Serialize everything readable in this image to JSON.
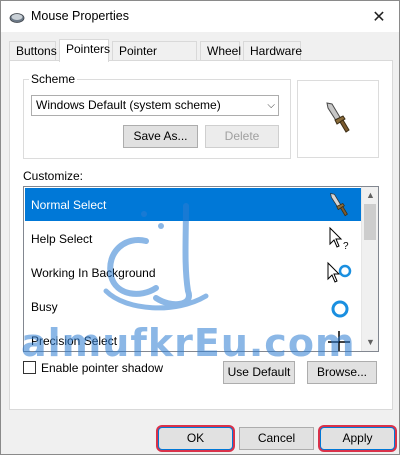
{
  "window": {
    "title": "Mouse Properties",
    "close_glyph": "✕"
  },
  "tabs": [
    {
      "label": "Buttons",
      "active": false
    },
    {
      "label": "Pointers",
      "active": true
    },
    {
      "label": "Pointer Options",
      "active": false
    },
    {
      "label": "Wheel",
      "active": false
    },
    {
      "label": "Hardware",
      "active": false
    }
  ],
  "scheme": {
    "group_label": "Scheme",
    "selected": "Windows Default (system scheme)",
    "save_as_label": "Save As...",
    "delete_label": "Delete"
  },
  "customize": {
    "label": "Customize:",
    "items": [
      {
        "name": "Normal Select",
        "selected": true,
        "icon": "sword-cursor-icon"
      },
      {
        "name": "Help Select",
        "selected": false,
        "icon": "help-select-cursor-icon"
      },
      {
        "name": "Working In Background",
        "selected": false,
        "icon": "working-background-cursor-icon"
      },
      {
        "name": "Busy",
        "selected": false,
        "icon": "busy-ring-cursor-icon"
      },
      {
        "name": "Precision Select",
        "selected": false,
        "icon": "crosshair-cursor-icon"
      }
    ]
  },
  "shadow": {
    "label": "Enable pointer shadow",
    "checked": false
  },
  "buttons": {
    "use_default": "Use Default",
    "browse": "Browse...",
    "ok": "OK",
    "cancel": "Cancel",
    "apply": "Apply"
  },
  "watermark": {
    "text": "almufkrEu.com"
  },
  "colors": {
    "selection": "#0078d7",
    "accent_ring": "#d9324a",
    "watermark": "#2d7dd2"
  }
}
